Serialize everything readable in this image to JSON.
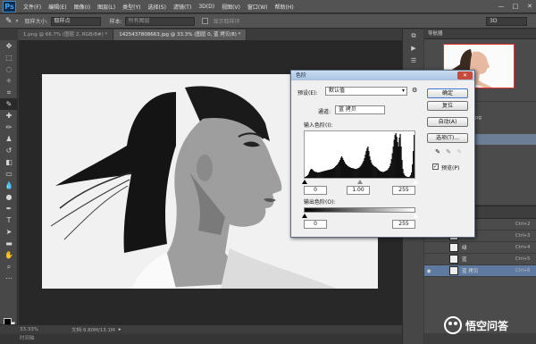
{
  "menubar": {
    "logo": "Ps",
    "items": [
      "文件(F)",
      "编辑(E)",
      "图像(I)",
      "图层(L)",
      "类型(Y)",
      "选择(S)",
      "滤镜(T)",
      "3D(D)",
      "视图(V)",
      "窗口(W)",
      "帮助(H)"
    ],
    "window_buttons": [
      "—",
      "□",
      "✕"
    ]
  },
  "options_bar": {
    "tool_icon": "eyedropper-icon",
    "sample_size_label": "取样大小:",
    "sample_size_value": "取样点",
    "sample_label": "样本:",
    "sample_value": "所有图层",
    "show_ring_label": "显示取样环",
    "workspace_value": "3D"
  },
  "doc_tabs": [
    {
      "label": "1.png @ 66.7% (图层 2, RGB/8#) *",
      "active": false
    },
    {
      "label": "1425437808663.jpg @ 33.3% (图层 0, 蓝 拷贝/8) *",
      "active": true
    }
  ],
  "status": {
    "zoom": "33.33%",
    "doc_info": "文档:9.80M/13.1M",
    "timeline_label": "时间轴"
  },
  "navigator": {
    "title": "导航器"
  },
  "history": {
    "items": [
      "",
      "...663.jpg",
      "",
      "",
      ""
    ],
    "selected_index": 3
  },
  "layers": {
    "rows": [
      {
        "name": "",
        "shortcut": "Ctrl+2",
        "selected": false,
        "visible": false
      },
      {
        "name": "红",
        "shortcut": "Ctrl+3",
        "selected": false,
        "visible": false
      },
      {
        "name": "绿",
        "shortcut": "Ctrl+4",
        "selected": false,
        "visible": false
      },
      {
        "name": "蓝",
        "shortcut": "Ctrl+5",
        "selected": false,
        "visible": false
      },
      {
        "name": "蓝 拷贝",
        "shortcut": "Ctrl+6",
        "selected": true,
        "visible": true
      }
    ]
  },
  "levels_dialog": {
    "title": "色阶",
    "preset_label": "预设(E):",
    "preset_value": "默认值",
    "channel_label": "通道:",
    "channel_value": "蓝 拷贝",
    "input_label": "输入色阶(I):",
    "input_values": [
      "0",
      "1.00",
      "255"
    ],
    "output_label": "输出色阶(O):",
    "output_values": [
      "0",
      "255"
    ],
    "buttons": {
      "ok": "确定",
      "reset": "复位",
      "auto": "自动(A)",
      "options": "选项(T)..."
    },
    "preview_label": "预览(P)",
    "preview_checked": true,
    "histogram": [
      2,
      3,
      4,
      6,
      9,
      14,
      18,
      20,
      19,
      17,
      15,
      14,
      13,
      13,
      12,
      12,
      12,
      13,
      13,
      14,
      14,
      15,
      15,
      16,
      16,
      17,
      17,
      18,
      18,
      19,
      19,
      20,
      21,
      22,
      24,
      26,
      28,
      30,
      33,
      36,
      40,
      45,
      48,
      44,
      40,
      36,
      32,
      30,
      28,
      26,
      25,
      24,
      23,
      22,
      22,
      21,
      21,
      20,
      20,
      20,
      21,
      22,
      23,
      25,
      27,
      30,
      34,
      38,
      44,
      52,
      60,
      66,
      70,
      60,
      48,
      40,
      34,
      30,
      28,
      26,
      25,
      24,
      22,
      20,
      18,
      16,
      15,
      14,
      14,
      13,
      13,
      14,
      15,
      16,
      17,
      19,
      22,
      26,
      32,
      42,
      55,
      70,
      85,
      96,
      100,
      92,
      80,
      70,
      90,
      98,
      70,
      40,
      20,
      10,
      6,
      4,
      3,
      2,
      2,
      2,
      3,
      6,
      12,
      30,
      60,
      96
    ]
  },
  "watermark": {
    "text": "悟空问答"
  }
}
